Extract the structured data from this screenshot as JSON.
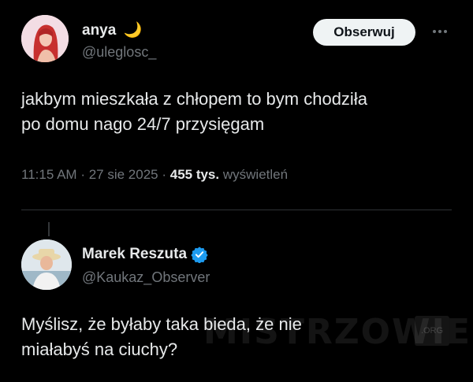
{
  "tweet": {
    "author_name": "anya",
    "author_emoji": "🌙",
    "author_handle": "@uleglosc_",
    "follow_label": "Obserwuj",
    "text_line1": "jakbym mieszkała z chłopem to bym chodziła",
    "text_line2": "po domu nago 24/7 przysięgam",
    "time": "11:15 AM",
    "date": "27 sie 2025",
    "views_count": "455 tys.",
    "views_label": "wyświetleń"
  },
  "reply": {
    "author_name": "Marek Reszuta",
    "author_handle": "@Kaukaz_Observer",
    "text_line1": "Myślisz, że byłaby taka bieda, że nie",
    "text_line2": "miałabyś na ciuchy?"
  },
  "watermark": {
    "text": "MISTRZOWIE",
    "badge": ".ORG"
  },
  "colors": {
    "background": "#000000",
    "text": "#e7e9ea",
    "muted": "#71767b",
    "verified": "#1d9bf0",
    "button_bg": "#eff3f4"
  }
}
